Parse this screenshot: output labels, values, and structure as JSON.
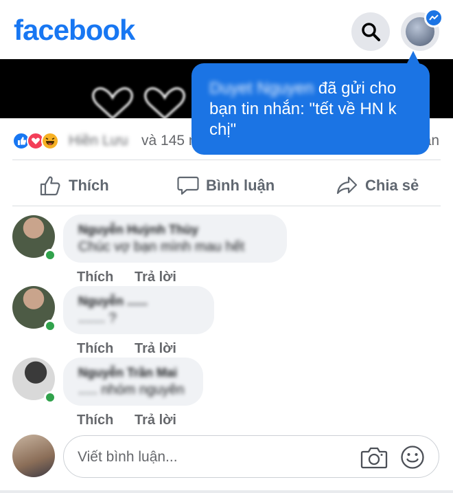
{
  "header": {
    "logo_text": "facebook",
    "search_icon": "search-icon",
    "profile_icon": "profile-avatar",
    "messenger_badge_icon": "messenger-icon"
  },
  "tooltip": {
    "sender_name": "Duyet Nguyen",
    "message": " đã gửi cho bạn tin nhắn: \"tết về HN k chị\""
  },
  "reactions": {
    "icons": [
      "like-reaction-icon",
      "love-reaction-icon",
      "haha-reaction-icon"
    ],
    "names": "Hiền Lưu",
    "count_text": "và 145 n",
    "comments_text": "ận"
  },
  "actions": {
    "like": "Thích",
    "comment": "Bình luận",
    "share": "Chia sẻ"
  },
  "comments": [
    {
      "author": "Nguyễn Huỳnh Thùy",
      "text": "Chúc vợ bạn mình mau hết",
      "like_label": "Thích",
      "reply_label": "Trả lời"
    },
    {
      "author": "Nguyễn ......",
      "text": "....... ?",
      "like_label": "Thích",
      "reply_label": "Trả lời"
    },
    {
      "author": "Nguyễn Trần Mai",
      "text": "..... nhóm nguyên",
      "like_label": "Thích",
      "reply_label": "Trả lời"
    }
  ],
  "composer": {
    "placeholder": "Viết bình luận...",
    "camera_icon": "camera-icon",
    "emoji_icon": "emoji-icon"
  },
  "colors": {
    "brand": "#1877f2",
    "tooltip": "#1b74e4",
    "online": "#31a24c",
    "bubble": "#f0f2f5"
  }
}
